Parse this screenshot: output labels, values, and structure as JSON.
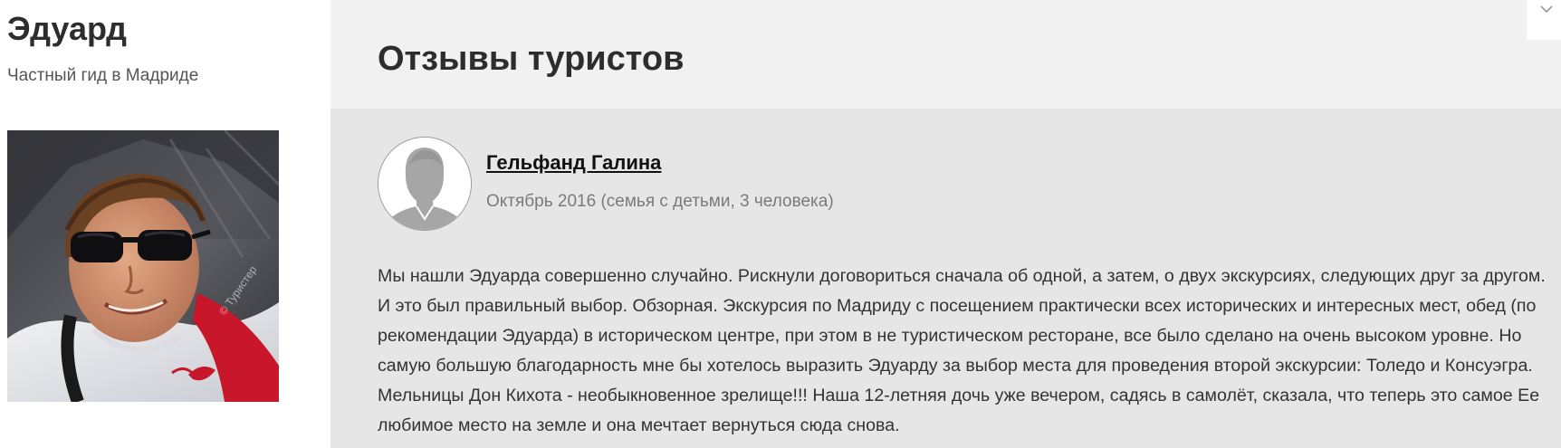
{
  "guide": {
    "name": "Эдуард",
    "subtitle": "Частный гид в Мадриде",
    "photo_watermark": "© Туристер"
  },
  "reviews_section": {
    "title": "Отзывы туристов"
  },
  "review": {
    "author": "Гельфанд Галина",
    "meta": "Октябрь 2016 (семья с детьми, 3 человека)",
    "text": "Мы нашли Эдуарда совершенно случайно. Рискнули договориться сначала об одной, а затем, о двух экскурсиях, следующих друг за другом. И это был правильный выбор. Обзорная. Экскурсия по Мадриду с посещением практически всех исторических и интересных мест, обед (по рекомендации Эдуарда) в историческом центре, при этом в не туристическом ресторане, все было сделано на очень высоком уровне. Но самую большую благодарность мне бы хотелось выразить Эдуарду за выбор места для проведения второй экскурсии: Толедо и Консуэгра. Мельницы Дон Кихота - необыкновенное зрелище!!! Наша 12-летняя дочь уже вечером, садясь в самолёт, сказала, что теперь это самое Ее любимое место на земле и она мечтает вернуться сюда снова."
  },
  "colors": {
    "sidebar_bg": "#ffffff",
    "header_bg": "#f1f1f1",
    "review_bg": "#e6e6e6",
    "title_text": "#2d2d2d",
    "meta_text": "#7a7a7a"
  },
  "icons": {
    "corner": "chevron-down-icon",
    "avatar": "user-silhouette-icon"
  }
}
